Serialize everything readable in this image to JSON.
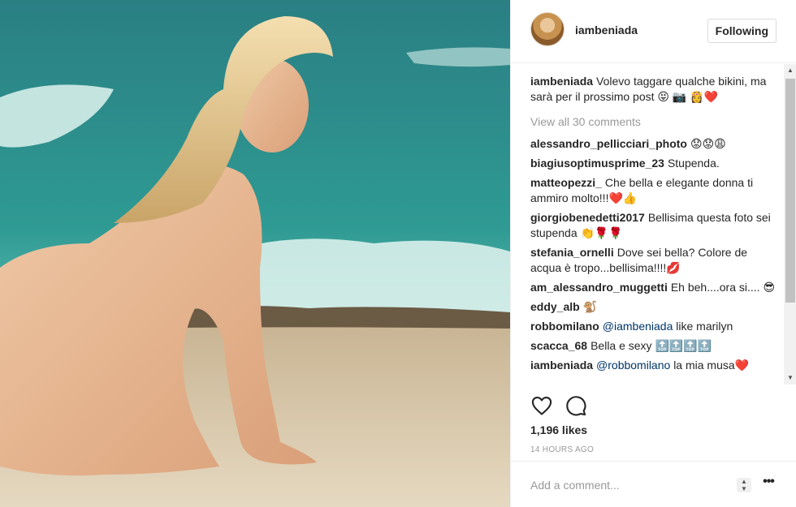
{
  "post": {
    "username": "iambeniada",
    "follow_label": "Following"
  },
  "caption": {
    "user": "iambeniada",
    "text": "Volevo taggare qualche bikini, ma sarà per il prossimo post 😝 📷 👸❤️"
  },
  "view_all_label": "View all 30 comments",
  "comments": [
    {
      "user": "alessandro_pellicciari_photo",
      "text": "😟😟😩"
    },
    {
      "user": "biagiusoptimusprime_23",
      "text": "Stupenda."
    },
    {
      "user": "matteopezzi_",
      "text": "Che bella e elegante donna ti ammiro molto!!!❤️👍"
    },
    {
      "user": "giorgiobenedetti2017",
      "text": "Bellisima questa foto sei stupenda 👏🌹🌹"
    },
    {
      "user": "stefania_ornelli",
      "text": "Dove sei bella? Colore de acqua è tropo...bellisima!!!!💋"
    },
    {
      "user": "am_alessandro_muggetti",
      "text": "Eh beh....ora si.... 😎"
    },
    {
      "user": "eddy_alb",
      "text": "🐒"
    },
    {
      "user": "robbomilano",
      "mention": "@iambeniada",
      "text": "like marilyn"
    },
    {
      "user": "scacca_68",
      "text": "Bella e sexy 🔝🔝🔝🔝"
    },
    {
      "user": "iambeniada",
      "mention": "@robbomilano",
      "text": "la mia musa❤️"
    }
  ],
  "likes_label": "1,196 likes",
  "timestamp": "14 HOURS AGO",
  "add_comment_placeholder": "Add a comment...",
  "icons": {
    "like": "heart-icon",
    "comment": "speech-bubble-icon",
    "more": "more-options-icon"
  },
  "colors": {
    "mention": "#003569",
    "muted": "#999999",
    "border": "#efefef",
    "sea": "#2f8f8c",
    "sand": "#d9c7a5"
  }
}
